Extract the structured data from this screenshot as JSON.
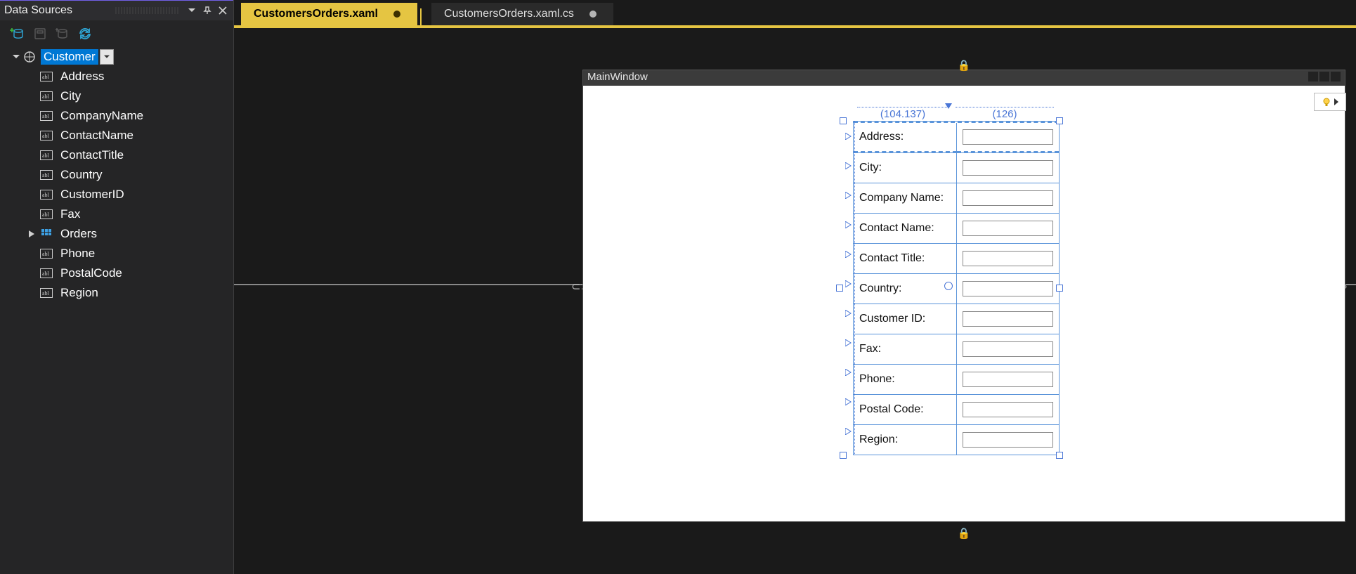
{
  "panel": {
    "title": "Data Sources"
  },
  "tree": {
    "root": {
      "label": "Customer",
      "children": [
        {
          "label": "Address",
          "kind": "abc"
        },
        {
          "label": "City",
          "kind": "abc"
        },
        {
          "label": "CompanyName",
          "kind": "abc"
        },
        {
          "label": "ContactName",
          "kind": "abc"
        },
        {
          "label": "ContactTitle",
          "kind": "abc"
        },
        {
          "label": "Country",
          "kind": "abc"
        },
        {
          "label": "CustomerID",
          "kind": "abc"
        },
        {
          "label": "Fax",
          "kind": "abc"
        },
        {
          "label": "Orders",
          "kind": "grid",
          "expandable": true
        },
        {
          "label": "Phone",
          "kind": "abc"
        },
        {
          "label": "PostalCode",
          "kind": "abc"
        },
        {
          "label": "Region",
          "kind": "abc"
        }
      ]
    }
  },
  "tabs": [
    {
      "label": "CustomersOrders.xaml",
      "dirty": true,
      "active": true
    },
    {
      "label": "CustomersOrders.xaml.cs",
      "dirty": true,
      "active": false
    }
  ],
  "designer": {
    "window_title": "MainWindow",
    "col_measures": [
      "(104.137)",
      "(126)"
    ],
    "form_rows": [
      {
        "label": "Address:"
      },
      {
        "label": "City:"
      },
      {
        "label": "Company Name:"
      },
      {
        "label": "Contact Name:"
      },
      {
        "label": "Contact Title:"
      },
      {
        "label": "Country:"
      },
      {
        "label": "Customer ID:"
      },
      {
        "label": "Fax:"
      },
      {
        "label": "Phone:"
      },
      {
        "label": "Postal Code:"
      },
      {
        "label": "Region:"
      }
    ]
  }
}
